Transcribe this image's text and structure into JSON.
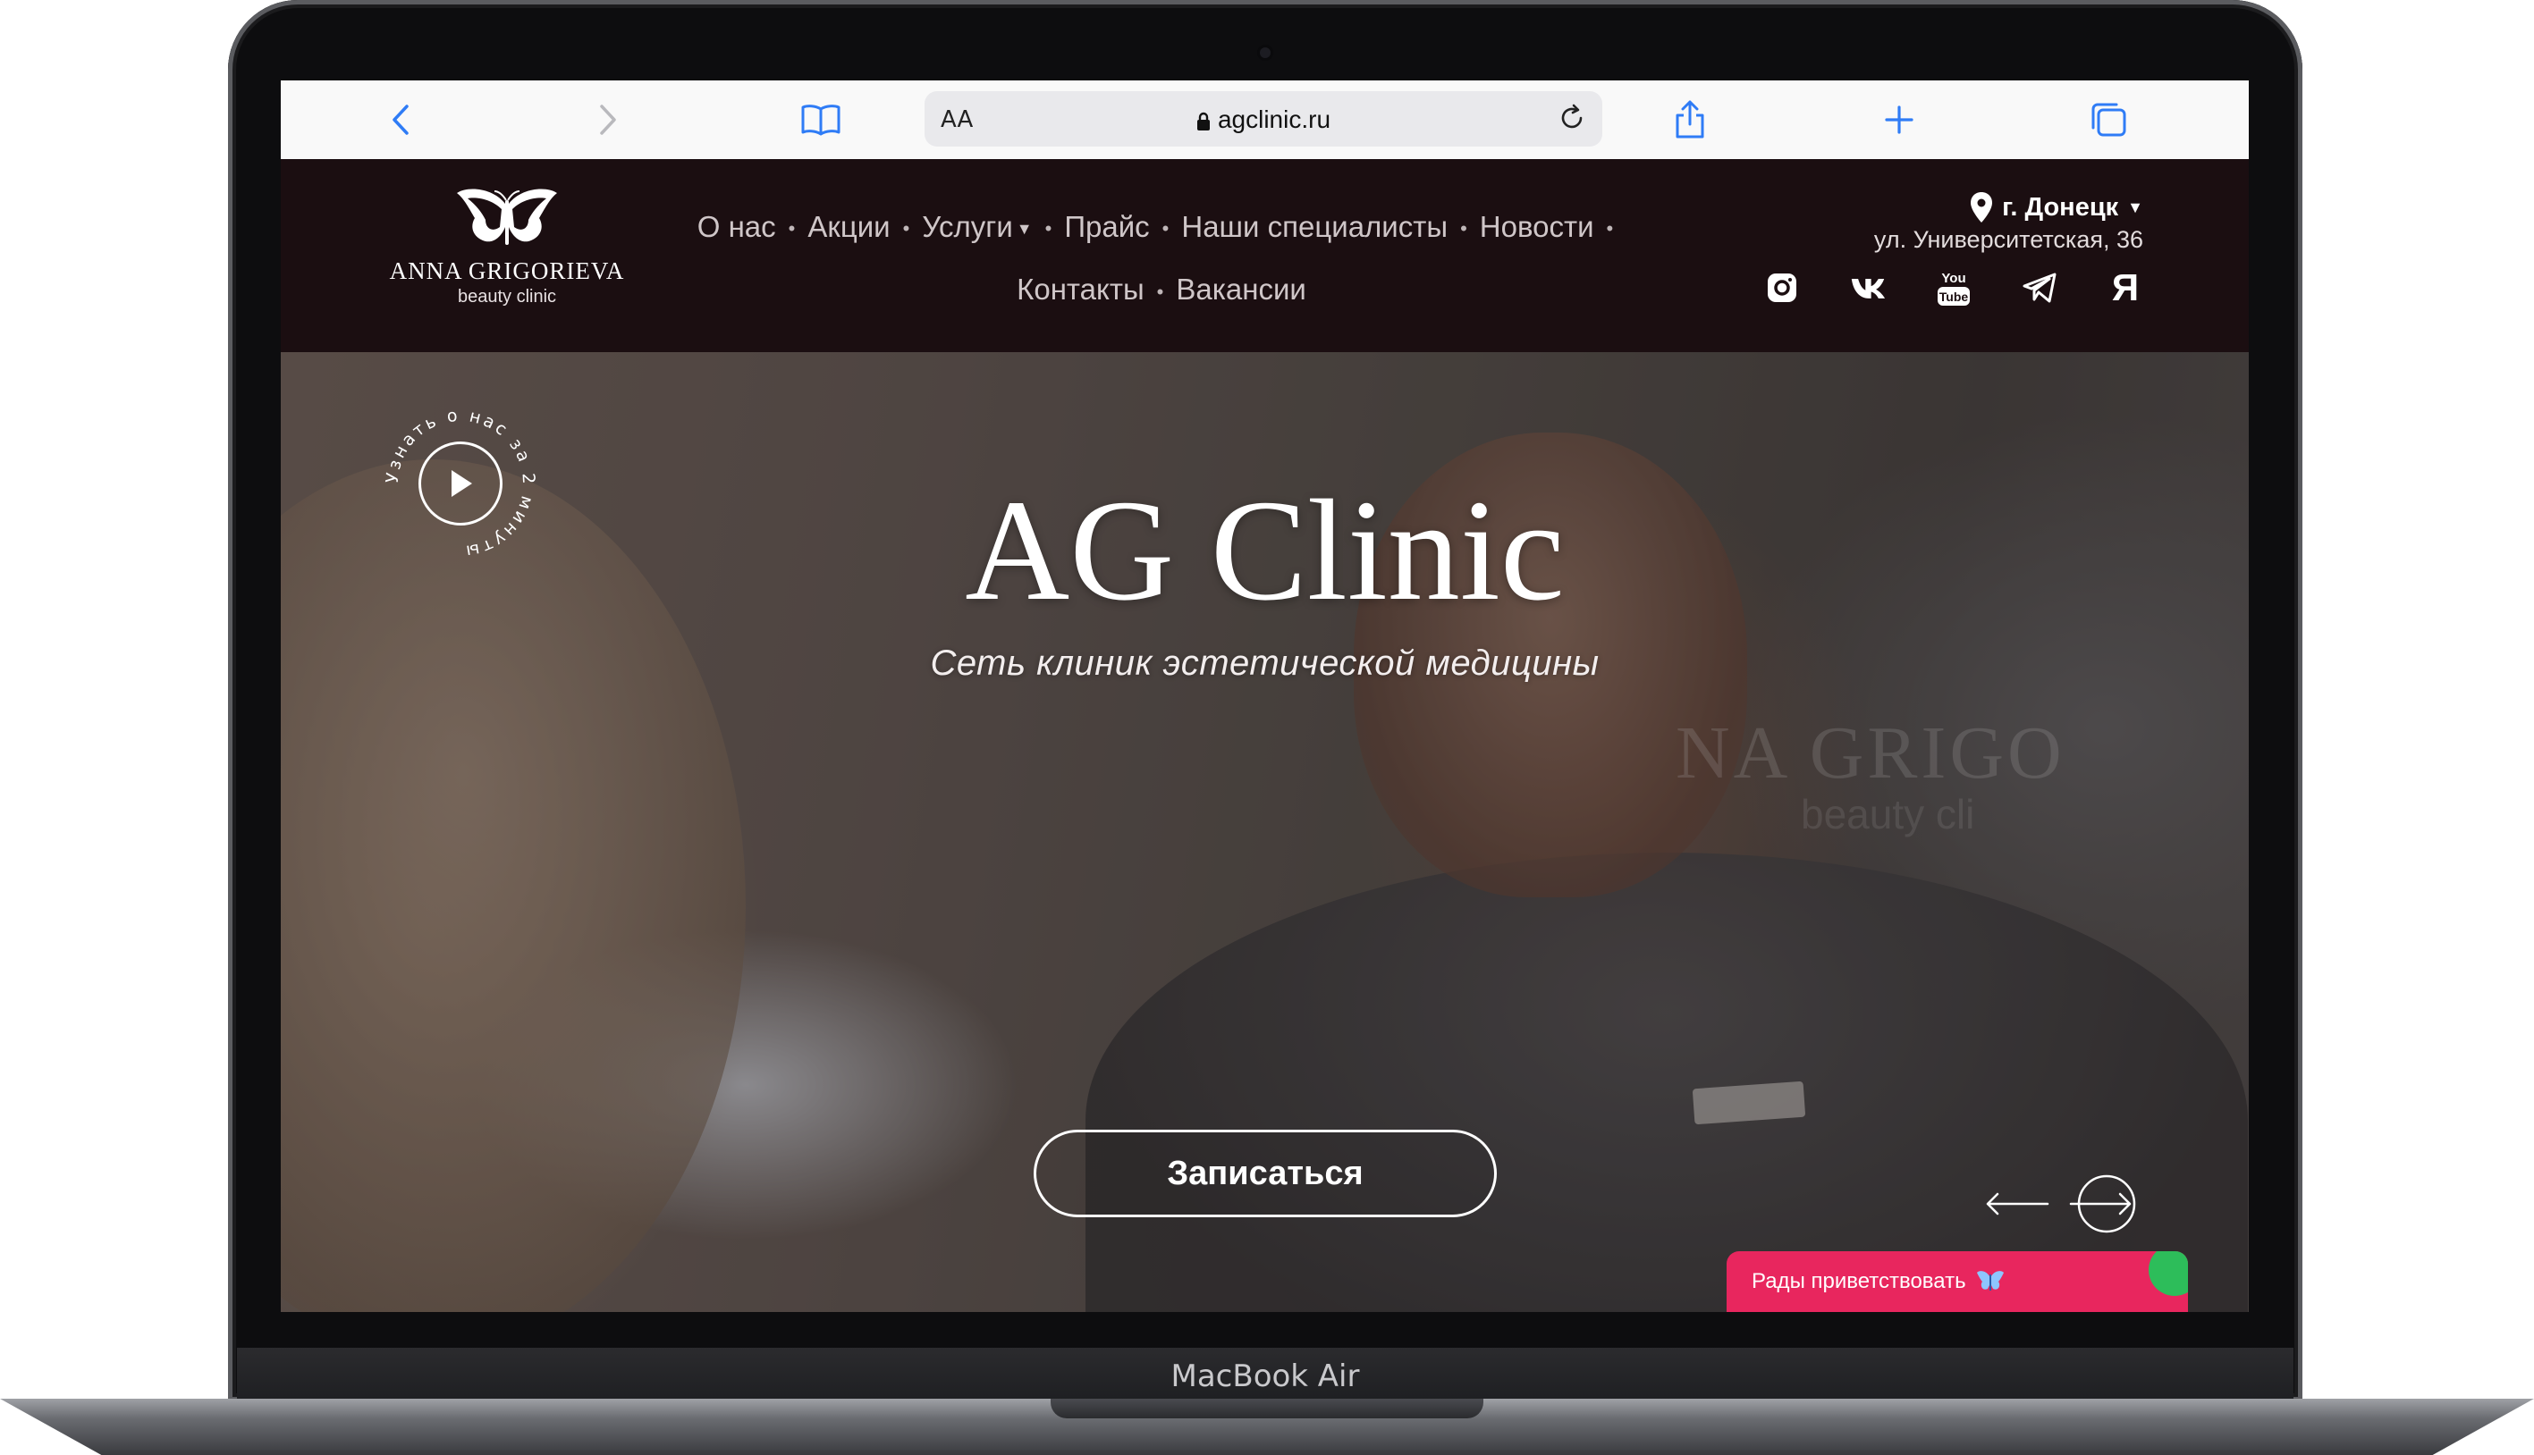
{
  "device": {
    "label": "MacBook Air"
  },
  "browser": {
    "aa_label": "AA",
    "url": "agclinic.ru"
  },
  "site": {
    "logo": {
      "name": "ANNA GRIGORIEVA",
      "sub": "beauty clinic"
    },
    "nav": {
      "row1": [
        "О нас",
        "Акции",
        "Услуги",
        "Прайс",
        "Наши специалисты",
        "Новости"
      ],
      "row2": [
        "Контакты",
        "Вакансии"
      ]
    },
    "city": "г. Донецк",
    "address": "ул. Университетская, 36",
    "socials": [
      "instagram-icon",
      "vk-icon",
      "youtube-icon",
      "telegram-icon",
      "yandex-icon"
    ],
    "yandex_letter": "Я",
    "youtube_label": "You Tube"
  },
  "hero": {
    "title": "AG Clinic",
    "subtitle": "Сеть клиник эстетической медицины",
    "video_badge_text": "Узнать о нас за 2 минуты",
    "cta_label": "Записаться",
    "watermark": "NA GRIGO",
    "watermark_sub": "beauty cli"
  },
  "chat": {
    "label": "Рады приветствовать",
    "accent": "#e8265e"
  },
  "colors": {
    "header_bg": "#1b0e11",
    "accent": "#e8265e"
  }
}
